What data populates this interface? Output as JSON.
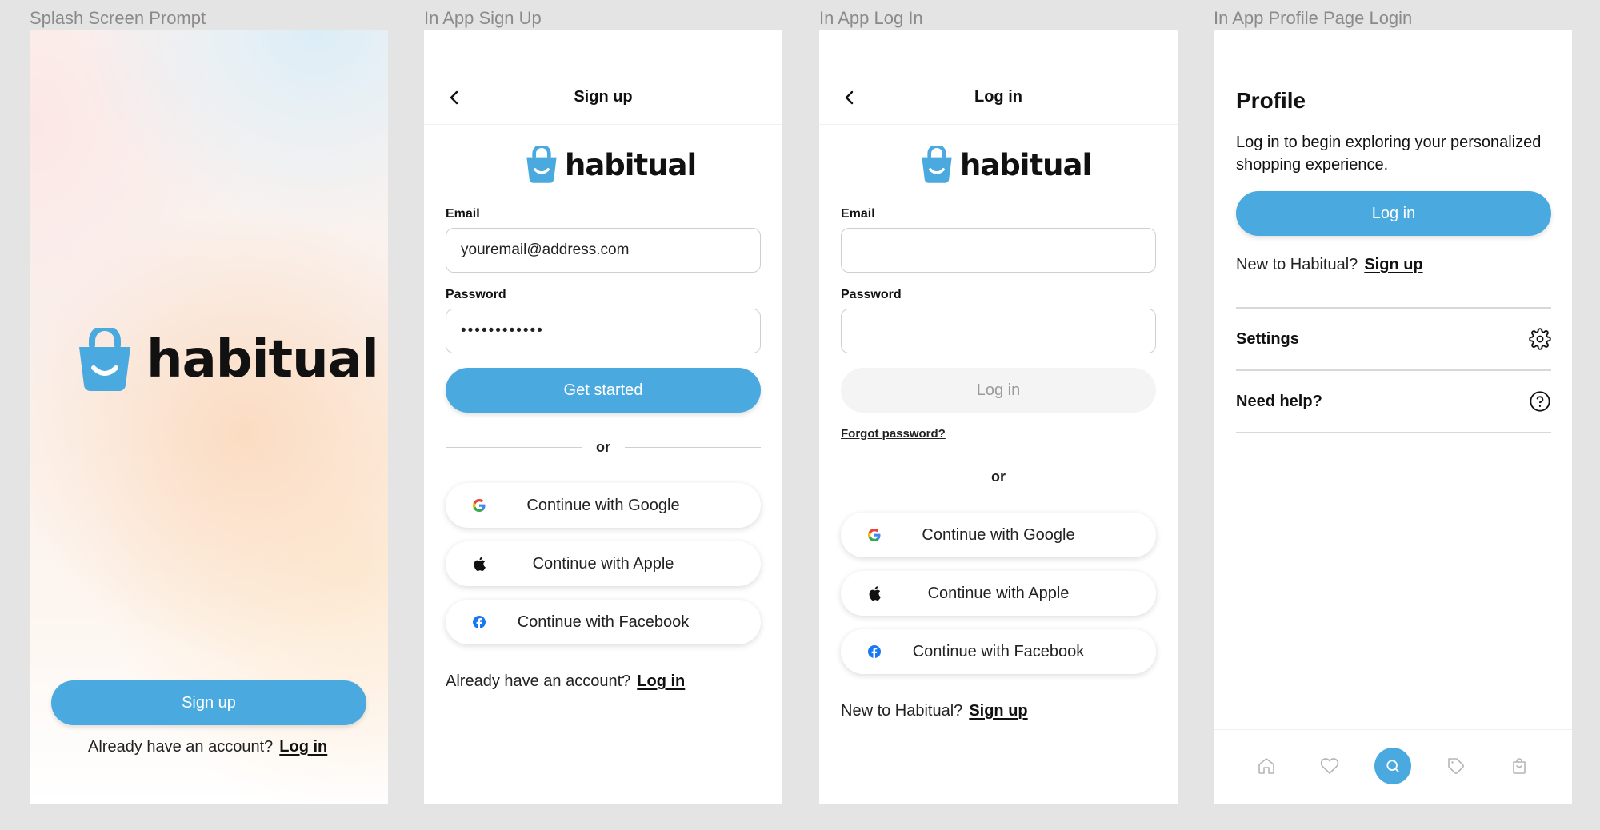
{
  "frames": {
    "splash": {
      "label": "Splash Screen Prompt",
      "brand": "habitual",
      "signup_button": "Sign up",
      "footer_text": "Already have an account?",
      "footer_link": "Log in"
    },
    "signup": {
      "label": "In App Sign Up",
      "title": "Sign up",
      "brand": "habitual",
      "email_label": "Email",
      "email_value": "youremail@address.com",
      "password_label": "Password",
      "password_value": "••••••••••••",
      "primary_button": "Get started",
      "divider_text": "or",
      "google_button": "Continue with Google",
      "apple_button": "Continue with Apple",
      "facebook_button": "Continue with Facebook",
      "footer_text": "Already have an account?",
      "footer_link": "Log in"
    },
    "login": {
      "label": "In App Log In",
      "title": "Log in",
      "brand": "habitual",
      "email_label": "Email",
      "email_value": "",
      "password_label": "Password",
      "password_value": "",
      "primary_button": "Log in",
      "forgot_link": "Forgot password?",
      "divider_text": "or",
      "google_button": "Continue with Google",
      "apple_button": "Continue with Apple",
      "facebook_button": "Continue with Facebook",
      "footer_text": "New to Habitual?",
      "footer_link": "Sign up"
    },
    "profile": {
      "label": "In App Profile Page Login",
      "title": "Profile",
      "description": "Log in to begin exploring your personalized shopping experience.",
      "login_button": "Log in",
      "footer_text": "New to Habitual?",
      "footer_link": "Sign up",
      "rows": [
        {
          "label": "Settings",
          "icon": "gear-icon"
        },
        {
          "label": "Need help?",
          "icon": "help-circle-icon"
        }
      ],
      "tabs": [
        {
          "icon": "home-icon",
          "active": false
        },
        {
          "icon": "heart-icon",
          "active": false
        },
        {
          "icon": "search-icon",
          "active": true
        },
        {
          "icon": "tag-icon",
          "active": false
        },
        {
          "icon": "bag-icon",
          "active": false
        }
      ]
    }
  },
  "colors": {
    "brand_blue": "#4aaae0",
    "text": "#111111",
    "canvas_bg": "#e4e4e4",
    "disabled_bg": "#f4f4f5"
  }
}
